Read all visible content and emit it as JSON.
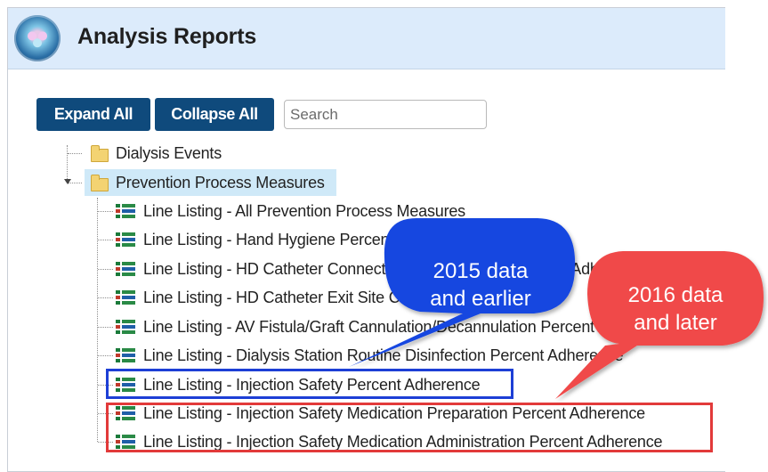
{
  "header": {
    "title": "Analysis Reports"
  },
  "toolbar": {
    "expand_label": "Expand All",
    "collapse_label": "Collapse All",
    "search_placeholder": "Search",
    "search_value": ""
  },
  "tree": {
    "folders": [
      {
        "label": "Dialysis Events"
      },
      {
        "label": "Prevention Process Measures"
      }
    ],
    "reports": [
      {
        "label": "Line Listing - All Prevention Process Measures"
      },
      {
        "label": "Line Listing - Hand Hygiene Percent Adherence"
      },
      {
        "label": "Line Listing - HD Catheter Connection/Disconnection Percent Adherence"
      },
      {
        "label": "Line Listing - HD Catheter Exit Site Care Percent Adherence"
      },
      {
        "label": "Line Listing - AV Fistula/Graft Cannulation/Decannulation Percent Adherence"
      },
      {
        "label": "Line Listing - Dialysis Station Routine Disinfection Percent Adherence"
      },
      {
        "label": "Line Listing - Injection Safety Percent Adherence"
      },
      {
        "label": "Line Listing - Injection Safety Medication Preparation Percent Adherence"
      },
      {
        "label": "Line Listing - Injection Safety Medication Administration Percent Adherence"
      }
    ]
  },
  "annotations": {
    "blue_callout": {
      "text": "2015 data and earlier",
      "line1": "2015 data",
      "line2": "and earlier",
      "color": "#1746e0"
    },
    "red_callout": {
      "text": "2016 data and later",
      "line1": "2016 data",
      "line2": "and later",
      "color": "#f04a4a"
    }
  },
  "colors": {
    "button_bg": "#0f4a7c",
    "header_bg": "#dcebfb",
    "selection_bg": "#cfe9f8",
    "blue_box": "#1d3fd6",
    "red_box": "#e23a3a"
  }
}
